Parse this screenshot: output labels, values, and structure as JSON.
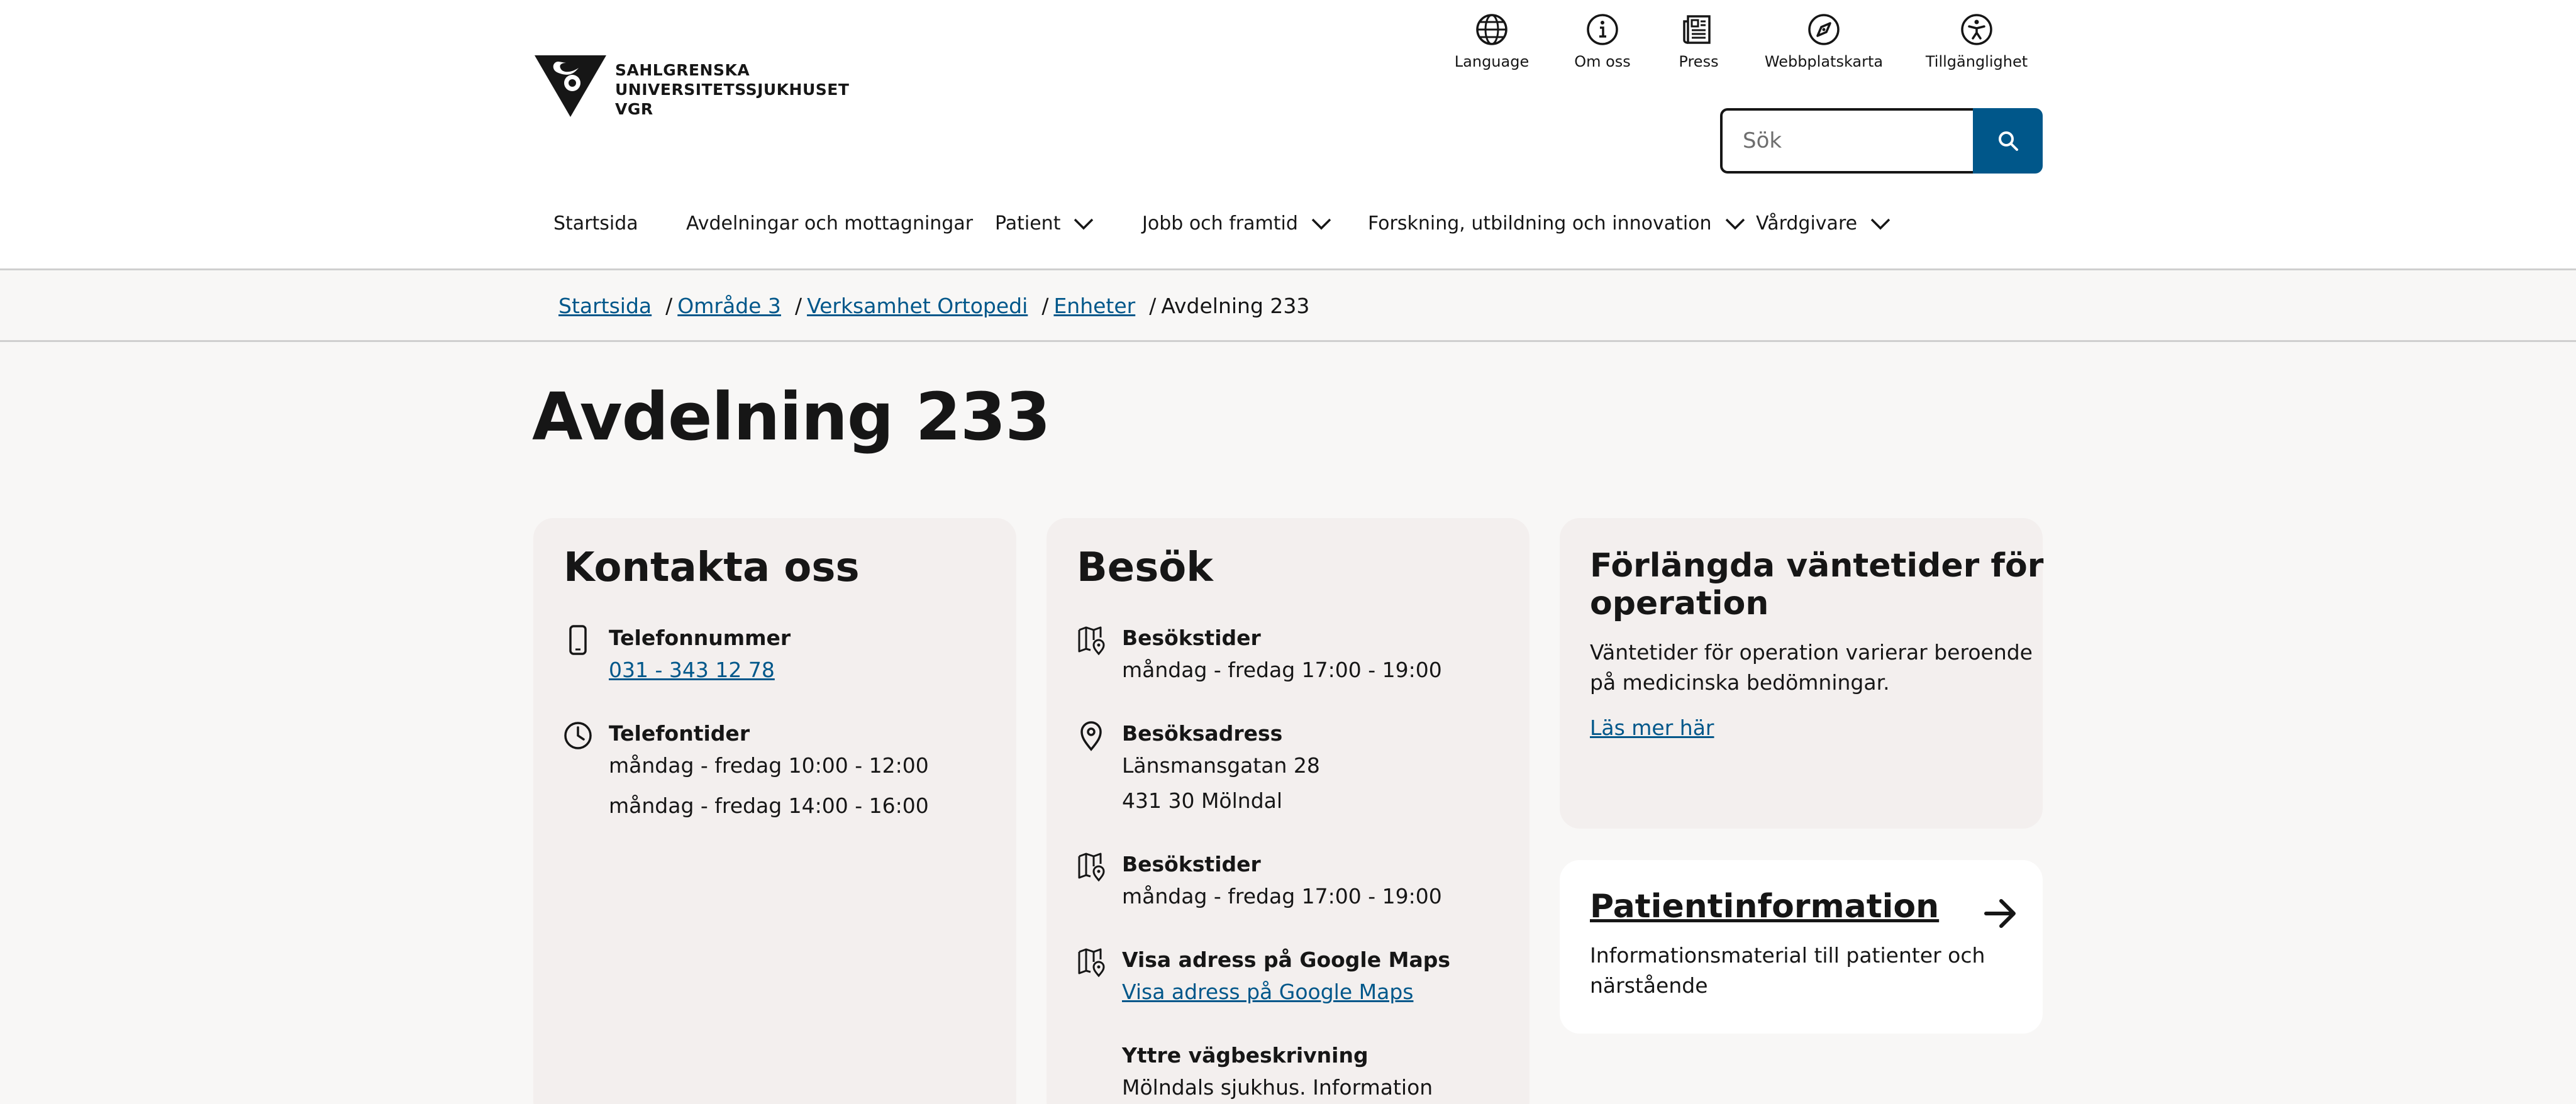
{
  "logo": {
    "lines": [
      "SAHLGRENSKA",
      "UNIVERSITETSSJUKHUSET",
      "VGR"
    ]
  },
  "utility_nav": [
    {
      "label": "Language",
      "icon": "globe-icon"
    },
    {
      "label": "Om oss",
      "icon": "info-icon"
    },
    {
      "label": "Press",
      "icon": "newspaper-icon"
    },
    {
      "label": "Webbplatskarta",
      "icon": "compass-icon"
    },
    {
      "label": "Tillgänglighet",
      "icon": "accessibility-icon"
    }
  ],
  "search": {
    "placeholder": "Sök",
    "value": "",
    "button_icon": "search-icon"
  },
  "main_nav": [
    {
      "label": "Startsida",
      "has_dropdown": false
    },
    {
      "label": "Avdelningar och mottagningar",
      "has_dropdown": false
    },
    {
      "label": "Patient",
      "has_dropdown": true
    },
    {
      "label": "Jobb och framtid",
      "has_dropdown": true
    },
    {
      "label": "Forskning, utbildning och innovation",
      "has_dropdown": true
    },
    {
      "label": "Vårdgivare",
      "has_dropdown": true
    }
  ],
  "breadcrumb": {
    "links": [
      "Startsida",
      "Område 3",
      "Verksamhet Ortopedi",
      "Enheter"
    ],
    "separator": "/",
    "current": "Avdelning 233"
  },
  "page_title": "Avdelning 233",
  "contact": {
    "title": "Kontakta oss",
    "phone_label": "Telefonnummer",
    "phone_number": "031 - 343 12 78",
    "hours_label": "Telefontider",
    "hours": [
      "måndag - fredag 10:00 - 12:00",
      "måndag - fredag 14:00 - 16:00"
    ]
  },
  "visit": {
    "title": "Besök",
    "visiting_hours_label": "Besökstider",
    "visiting_hours": "måndag - fredag 17:00 - 19:00",
    "address_label": "Besöksadress",
    "address_lines": [
      "Länsmansgatan 28",
      "431 30 Mölndal"
    ],
    "visiting_hours_2_label": "Besökstider",
    "visiting_hours_2": "måndag - fredag 17:00 - 19:00",
    "maps_label": "Visa adress på Google Maps",
    "maps_link": "Visa adress på Google Maps",
    "directions_label": "Yttre vägbeskrivning",
    "directions_text": "Mölndals sjukhus. Information"
  },
  "waiting": {
    "title_lines": [
      "Förlängda väntetider för",
      "operation"
    ],
    "text_lines": [
      "Väntetider för operation varierar beroende",
      "på medicinska bedömningar."
    ],
    "link": "Läs mer här"
  },
  "patient_info": {
    "title": "Patientinformation",
    "text_lines": [
      "Informationsmaterial till patienter och",
      "närstående"
    ]
  },
  "colors": {
    "link": "#00578a",
    "search_button": "#00578a",
    "card_background": "#f3efee",
    "page_background": "#f8f7f6",
    "text": "#161616"
  }
}
